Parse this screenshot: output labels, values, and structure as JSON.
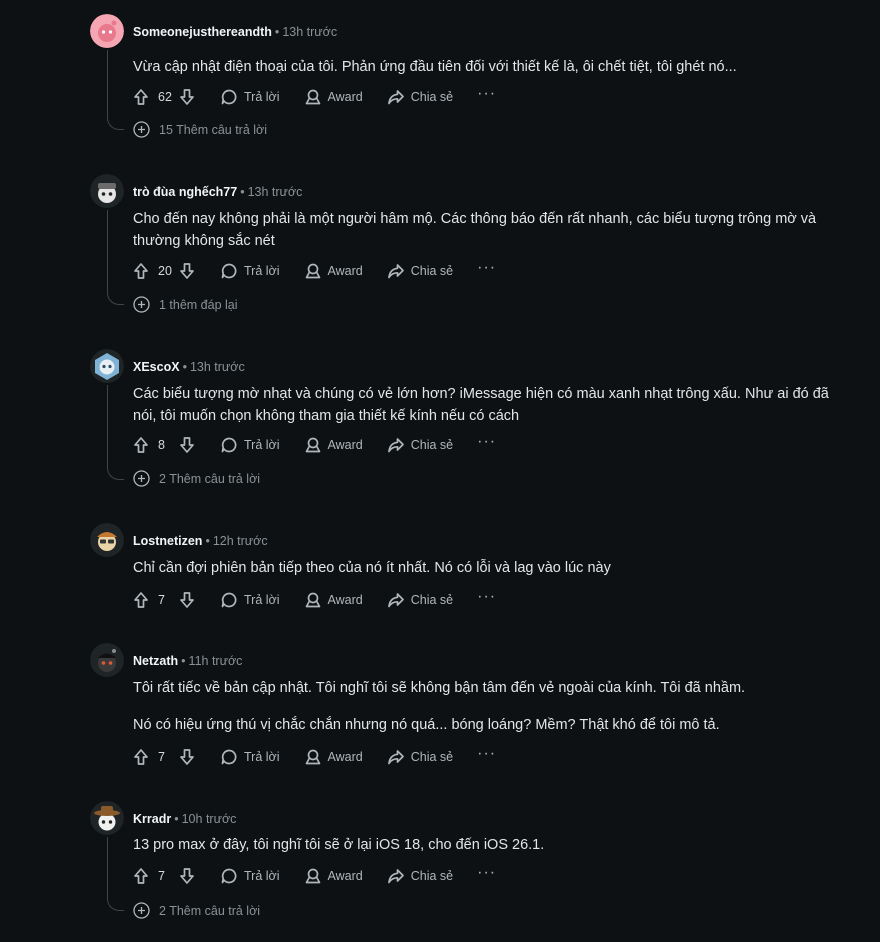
{
  "comments": [
    {
      "author": "Someonejusthereandth",
      "time": "13h trước",
      "avatar_icon": "pink-snoo-avatar",
      "body": [
        "Vừa cập nhật điện thoại của tôi. Phản ứng đầu tiên đối với thiết kế là, ôi chết tiệt, tôi ghét nó..."
      ],
      "votes": "62",
      "reply_label": "Trả lời",
      "award_label": "Award",
      "share_label": "Chia sẻ",
      "more_replies": "15 Thêm câu trả lời"
    },
    {
      "author": "trò đùa nghếch77",
      "time": "13h trước",
      "avatar_icon": "snoo-avatar-cap",
      "body": [
        "Cho đến nay không phải là một người hâm mộ. Các thông báo đến rất nhanh, các biểu tượng trông mờ và thường không sắc nét"
      ],
      "votes": "20",
      "reply_label": "Trả lời",
      "award_label": "Award",
      "share_label": "Chia sẻ",
      "more_replies": "1 thêm đáp lại"
    },
    {
      "author": "XEscoX",
      "time": "13h trước",
      "avatar_icon": "snoo-avatar-blue",
      "body": [
        "Các biểu tượng mờ nhạt và chúng có vẻ lớn hơn? iMessage hiện có màu xanh nhạt trông xấu. Như ai đó đã nói, tôi muốn chọn không tham gia thiết kế kính nếu có cách"
      ],
      "votes": "8",
      "reply_label": "Trả lời",
      "award_label": "Award",
      "share_label": "Chia sẻ",
      "more_replies": "2 Thêm câu trả lời"
    },
    {
      "author": "Lostnetizen",
      "time": "12h trước",
      "avatar_icon": "snoo-avatar-glasses",
      "body": [
        "Chỉ cần đợi phiên bản tiếp theo của nó ít nhất. Nó có lỗi và lag vào lúc này"
      ],
      "votes": "7",
      "reply_label": "Trả lời",
      "award_label": "Award",
      "share_label": "Chia sẻ",
      "more_replies": ""
    },
    {
      "author": "Netzath",
      "time": "11h trước",
      "avatar_icon": "snoo-avatar-dark",
      "body": [
        "Tôi rất tiếc về bản cập nhật. Tôi nghĩ tôi sẽ không bận tâm đến vẻ ngoài của kính. Tôi đã nhầm.",
        "Nó có hiệu ứng thú vị chắc chắn nhưng nó quá... bóng loáng? Mềm? Thật khó để tôi mô tả."
      ],
      "votes": "7",
      "reply_label": "Trả lời",
      "award_label": "Award",
      "share_label": "Chia sẻ",
      "more_replies": ""
    },
    {
      "author": "Krradr",
      "time": "10h trước",
      "avatar_icon": "snoo-avatar-hat",
      "body": [
        "13 pro max ở đây, tôi nghĩ tôi sẽ ở lại iOS 18, cho đến iOS 26.1."
      ],
      "votes": "7",
      "reply_label": "Trả lời",
      "award_label": "Award",
      "share_label": "Chia sẻ",
      "more_replies": "2 Thêm câu trả lời"
    }
  ],
  "icons": {
    "upvote": "upvote-arrow-icon",
    "downvote": "downvote-arrow-icon",
    "reply": "speech-bubble-icon",
    "award": "award-ribbon-icon",
    "share": "share-arrow-icon",
    "more": "ellipsis-icon",
    "expand": "plus-circle-icon"
  },
  "colors": {
    "background": "#0e1113",
    "text": "#e3e6e8",
    "muted": "#8a9296",
    "thread_line": "#3e4447"
  }
}
